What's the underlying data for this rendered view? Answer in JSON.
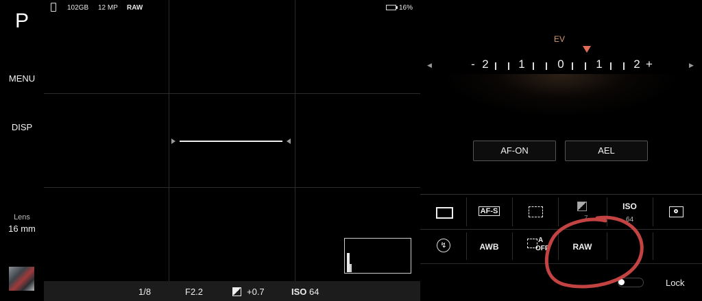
{
  "mode": "P",
  "left_rail": {
    "menu_label": "MENU",
    "disp_label": "DISP",
    "lens_label": "Lens",
    "lens_value": "16 mm"
  },
  "top_status": {
    "storage": "102GB",
    "megapixels": "12 MP",
    "format": "RAW",
    "battery": "16%"
  },
  "bottom_status": {
    "shutter": "1/8",
    "aperture": "F2.2",
    "ev": "+0.7",
    "iso_label": "ISO",
    "iso_value": "64"
  },
  "ev_panel": {
    "title": "EV",
    "scale": [
      "-",
      "2",
      "1",
      "0",
      "1",
      "2",
      "+"
    ],
    "current_value": 0.7
  },
  "buttons": {
    "af_on": "AF-ON",
    "ael": "AEL"
  },
  "quick_grid": {
    "row1": {
      "af_mode": "AF-S",
      "iso_label": "ISO",
      "iso_value": "64",
      "ev_value": "7"
    },
    "row2": {
      "wb": "AWB",
      "face_af_a": "A",
      "face_af_off": "OFF",
      "format": "RAW"
    }
  },
  "lock_label": "Lock",
  "colors": {
    "ev_accent": "#e06a55",
    "annotation": "#d84a4a"
  }
}
